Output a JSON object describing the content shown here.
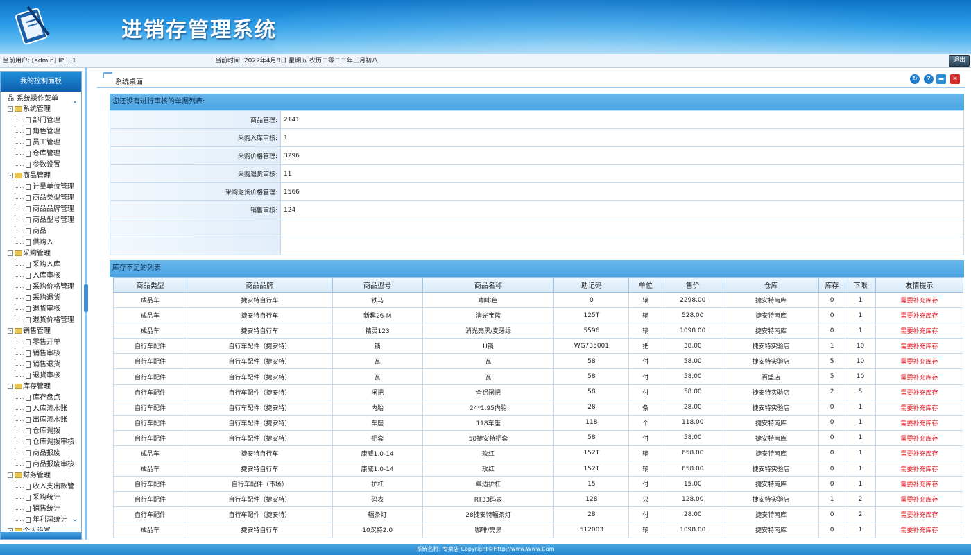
{
  "header": {
    "app_title": "进销存管理系统"
  },
  "infobar": {
    "user_text": "当前用户: [admin] IP: ::1",
    "time_text": "当前时间:  2022年4月8日 星期五 农历二零二二年三月初八",
    "logout_label": "退出"
  },
  "left_panel": {
    "title": "我的控制面板",
    "root_label": "系统操作菜单",
    "groups": [
      {
        "label": "系统管理",
        "items": [
          "部门管理",
          "角色管理",
          "员工管理",
          "仓库管理",
          "参数设置"
        ]
      },
      {
        "label": "商品管理",
        "items": [
          "计量单位管理",
          "商品类型管理",
          "商品品牌管理",
          "商品型号管理",
          "商品",
          "供购入"
        ]
      },
      {
        "label": "采购管理",
        "items": [
          "采购入库",
          "入库审核",
          "采购价格管理",
          "采购退货",
          "退货审核",
          "退货价格管理"
        ]
      },
      {
        "label": "销售管理",
        "items": [
          "零售开单",
          "销售审核",
          "销售退货",
          "退货审核"
        ]
      },
      {
        "label": "库存管理",
        "items": [
          "库存盘点",
          "入库流水账",
          "出库流水账",
          "仓库调拨",
          "仓库调拨审核",
          "商品报废",
          "商品报废审核"
        ]
      },
      {
        "label": "财务管理",
        "items": [
          "收入支出款管",
          "采购统计",
          "销售统计",
          "年利润统计"
        ]
      },
      {
        "label": "个人设置",
        "items": []
      }
    ]
  },
  "main": {
    "desktop_label": "系统桌面",
    "audit_title": "您还没有进行审核的单据列表:",
    "audit_rows": [
      {
        "label": "商品管理:",
        "value": "2141"
      },
      {
        "label": "采购入库审核:",
        "value": "1"
      },
      {
        "label": "采购价格管理:",
        "value": "3296"
      },
      {
        "label": "采购退货审核:",
        "value": "11"
      },
      {
        "label": "采购退货价格管理:",
        "value": "1566"
      },
      {
        "label": "销售审核:",
        "value": "124"
      }
    ],
    "stock_title": "库存不足的列表",
    "stock_columns": [
      "商品类型",
      "商品品牌",
      "商品型号",
      "商品名称",
      "助记码",
      "单位",
      "售价",
      "仓库",
      "库存",
      "下限",
      "友情提示"
    ],
    "stock_rows": [
      [
        "成品车",
        "捷安特自行车",
        "铁马",
        "咖啡色",
        "0",
        "辆",
        "2298.00",
        "捷安特南库",
        "0",
        "1",
        "需要补充库存"
      ],
      [
        "成品车",
        "捷安特自行车",
        "新趣26-M",
        "消光宝蓝",
        "125T",
        "辆",
        "528.00",
        "捷安特南库",
        "0",
        "1",
        "需要补充库存"
      ],
      [
        "成品车",
        "捷安特自行车",
        "精灵123",
        "消光亮黑/麦牙绿",
        "5596",
        "辆",
        "1098.00",
        "捷安特南库",
        "0",
        "1",
        "需要补充库存"
      ],
      [
        "自行车配件",
        "自行车配件（捷安特）",
        "锁",
        "U锁",
        "WG735001",
        "把",
        "38.00",
        "捷安特实验店",
        "1",
        "10",
        "需要补充库存"
      ],
      [
        "自行车配件",
        "自行车配件（捷安特）",
        "瓦",
        "瓦",
        "58",
        "付",
        "58.00",
        "捷安特实验店",
        "5",
        "10",
        "需要补充库存"
      ],
      [
        "自行车配件",
        "自行车配件（捷安特）",
        "瓦",
        "瓦",
        "58",
        "付",
        "58.00",
        "百盛店",
        "5",
        "10",
        "需要补充库存"
      ],
      [
        "自行车配件",
        "自行车配件（捷安特）",
        "闸把",
        "全铝闸把",
        "58",
        "付",
        "58.00",
        "捷安特实验店",
        "2",
        "5",
        "需要补充库存"
      ],
      [
        "自行车配件",
        "自行车配件（捷安特）",
        "内胎",
        "24*1.95内胎",
        "28",
        "条",
        "28.00",
        "捷安特实验店",
        "0",
        "1",
        "需要补充库存"
      ],
      [
        "自行车配件",
        "自行车配件（捷安特）",
        "车座",
        "118车座",
        "118",
        "个",
        "118.00",
        "捷安特南库",
        "0",
        "1",
        "需要补充库存"
      ],
      [
        "自行车配件",
        "自行车配件（捷安特）",
        "把套",
        "58捷安特把套",
        "58",
        "付",
        "58.00",
        "捷安特南库",
        "0",
        "1",
        "需要补充库存"
      ],
      [
        "成品车",
        "捷安特自行车",
        "康威1.0-14",
        "玫红",
        "152T",
        "辆",
        "658.00",
        "捷安特南库",
        "0",
        "1",
        "需要补充库存"
      ],
      [
        "成品车",
        "捷安特自行车",
        "康威1.0-14",
        "玫红",
        "152T",
        "辆",
        "658.00",
        "捷安特实验店",
        "0",
        "1",
        "需要补充库存"
      ],
      [
        "自行车配件",
        "自行车配件（市场）",
        "护杠",
        "单边护杠",
        "15",
        "付",
        "15.00",
        "捷安特南库",
        "0",
        "1",
        "需要补充库存"
      ],
      [
        "自行车配件",
        "自行车配件（捷安特）",
        "码表",
        "RT33码表",
        "128",
        "只",
        "128.00",
        "捷安特实验店",
        "1",
        "2",
        "需要补充库存"
      ],
      [
        "自行车配件",
        "自行车配件（捷安特）",
        "辐条灯",
        "28捷安特辐条灯",
        "28",
        "付",
        "28.00",
        "捷安特南库",
        "0",
        "2",
        "需要补充库存"
      ],
      [
        "成品车",
        "捷安特自行车",
        "10汉特2.0",
        "咖啡/亮黑",
        "512003",
        "辆",
        "1098.00",
        "捷安特南库",
        "0",
        "1",
        "需要补充库存"
      ]
    ]
  },
  "footer": {
    "text": "系统名称: 专卖店  Copyright©Http://www.Www.Com"
  },
  "colors": {
    "header_blue": "#1a86d6",
    "warn_red": "#e0181f"
  },
  "icons": [
    "refresh-icon",
    "help-icon",
    "minimize-icon",
    "close-icon"
  ]
}
